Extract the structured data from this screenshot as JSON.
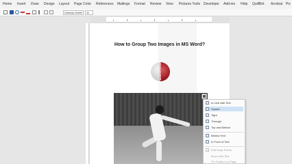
{
  "ribbon": {
    "tabs": [
      "Home",
      "Insert",
      "Draw",
      "Design",
      "Layout",
      "Page Color",
      "References",
      "Mailings",
      "Format",
      "Review",
      "View",
      "Pictures Tools",
      "Developer",
      "Add-ins",
      "Help",
      "QuillBot",
      "Acrobat",
      "Pic"
    ]
  },
  "toolbar": {
    "font_name": "Century Goth",
    "font_size": "11"
  },
  "document": {
    "title": "How to Group Two Images in MS Word?"
  },
  "wrap_menu": {
    "items": [
      "In Line with Text",
      "Square",
      "Tight",
      "Through",
      "Top and Bottom",
      "Behind Text",
      "In Front of Text",
      "Edit Wrap Points",
      "Move with Text",
      "Fix Position on Page"
    ],
    "highlighted_item": "Square"
  }
}
